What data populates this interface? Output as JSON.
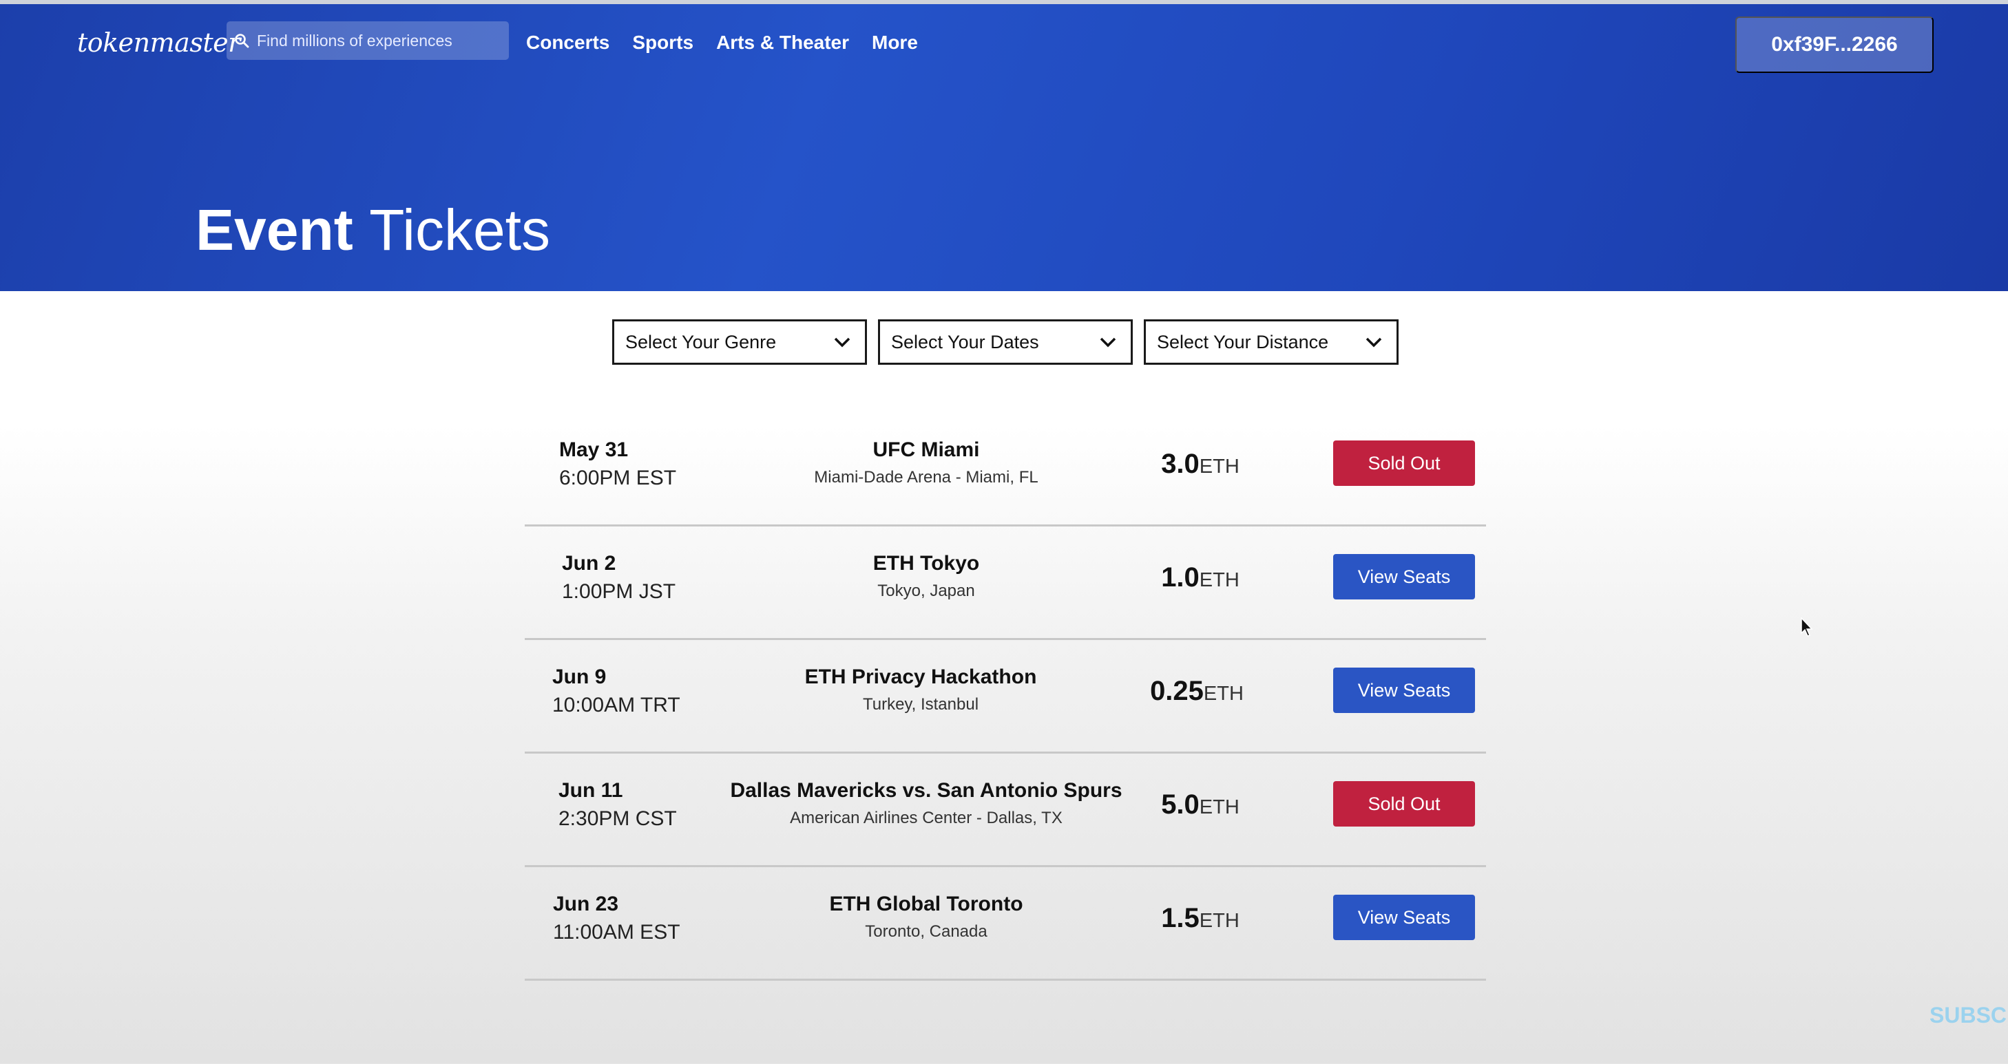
{
  "header": {
    "logo": "tokenmaster",
    "search_placeholder": "Find millions of experiences",
    "nav": [
      "Concerts",
      "Sports",
      "Arts & Theater",
      "More"
    ],
    "wallet": "0xf39F...2266"
  },
  "hero": {
    "title_bold": "Event",
    "title_light": "Tickets"
  },
  "filters": [
    "Select Your Genre",
    "Select Your Dates",
    "Select Your Distance"
  ],
  "events": [
    {
      "day": "May 31",
      "time": "6:00PM EST",
      "name": "UFC Miami",
      "venue": "Miami-Dade Arena - Miami, FL",
      "price": "3.0",
      "unit": "ETH",
      "button": "Sold Out",
      "status": "sold"
    },
    {
      "day": "Jun 2",
      "time": "1:00PM JST",
      "name": "ETH Tokyo",
      "venue": "Tokyo, Japan",
      "price": "1.0",
      "unit": "ETH",
      "button": "View Seats",
      "status": "view"
    },
    {
      "day": "Jun 9",
      "time": "10:00AM TRT",
      "name": "ETH Privacy Hackathon",
      "venue": "Turkey, Istanbul",
      "price": "0.25",
      "unit": "ETH",
      "button": "View Seats",
      "status": "view"
    },
    {
      "day": "Jun 11",
      "time": "2:30PM CST",
      "name": "Dallas Mavericks vs. San Antonio Spurs",
      "venue": "American Airlines Center - Dallas, TX",
      "price": "5.0",
      "unit": "ETH",
      "button": "Sold Out",
      "status": "sold"
    },
    {
      "day": "Jun 23",
      "time": "11:00AM EST",
      "name": "ETH Global Toronto",
      "venue": "Toronto, Canada",
      "price": "1.5",
      "unit": "ETH",
      "button": "View Seats",
      "status": "view"
    }
  ],
  "watermark": "SUBSCRIBE",
  "colors": {
    "hero_blue": "#2553c9",
    "sold_out_red": "#c0213f",
    "view_seats_blue": "#2a55c4"
  }
}
